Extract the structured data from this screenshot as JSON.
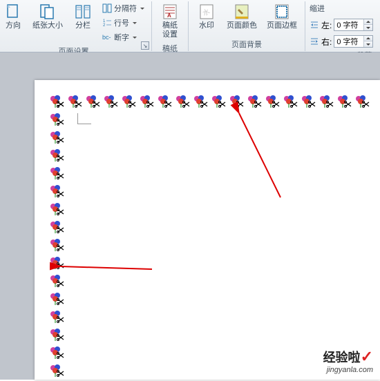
{
  "ribbon": {
    "page_setup": {
      "direction": "方向",
      "paper_size": "纸张大小",
      "columns": "分栏",
      "separator": "分隔符",
      "line_numbers": "行号",
      "hyphenation": "断字",
      "group_label": "页面设置"
    },
    "draft": {
      "draft_settings": "稿纸\n设置",
      "group_label": "稿纸"
    },
    "page_bg": {
      "watermark": "水印",
      "page_color": "页面颜色",
      "page_border": "页面边框",
      "group_label": "页面背景"
    },
    "indent": {
      "title": "缩进",
      "left_label": "左:",
      "right_label": "右:",
      "left_value": "0 字符",
      "right_value": "0 字符"
    },
    "paragraph": {
      "group_label": "段落"
    }
  },
  "watermark": {
    "title": "经验啦",
    "check": "✓",
    "sub": "jingyanla.com"
  }
}
